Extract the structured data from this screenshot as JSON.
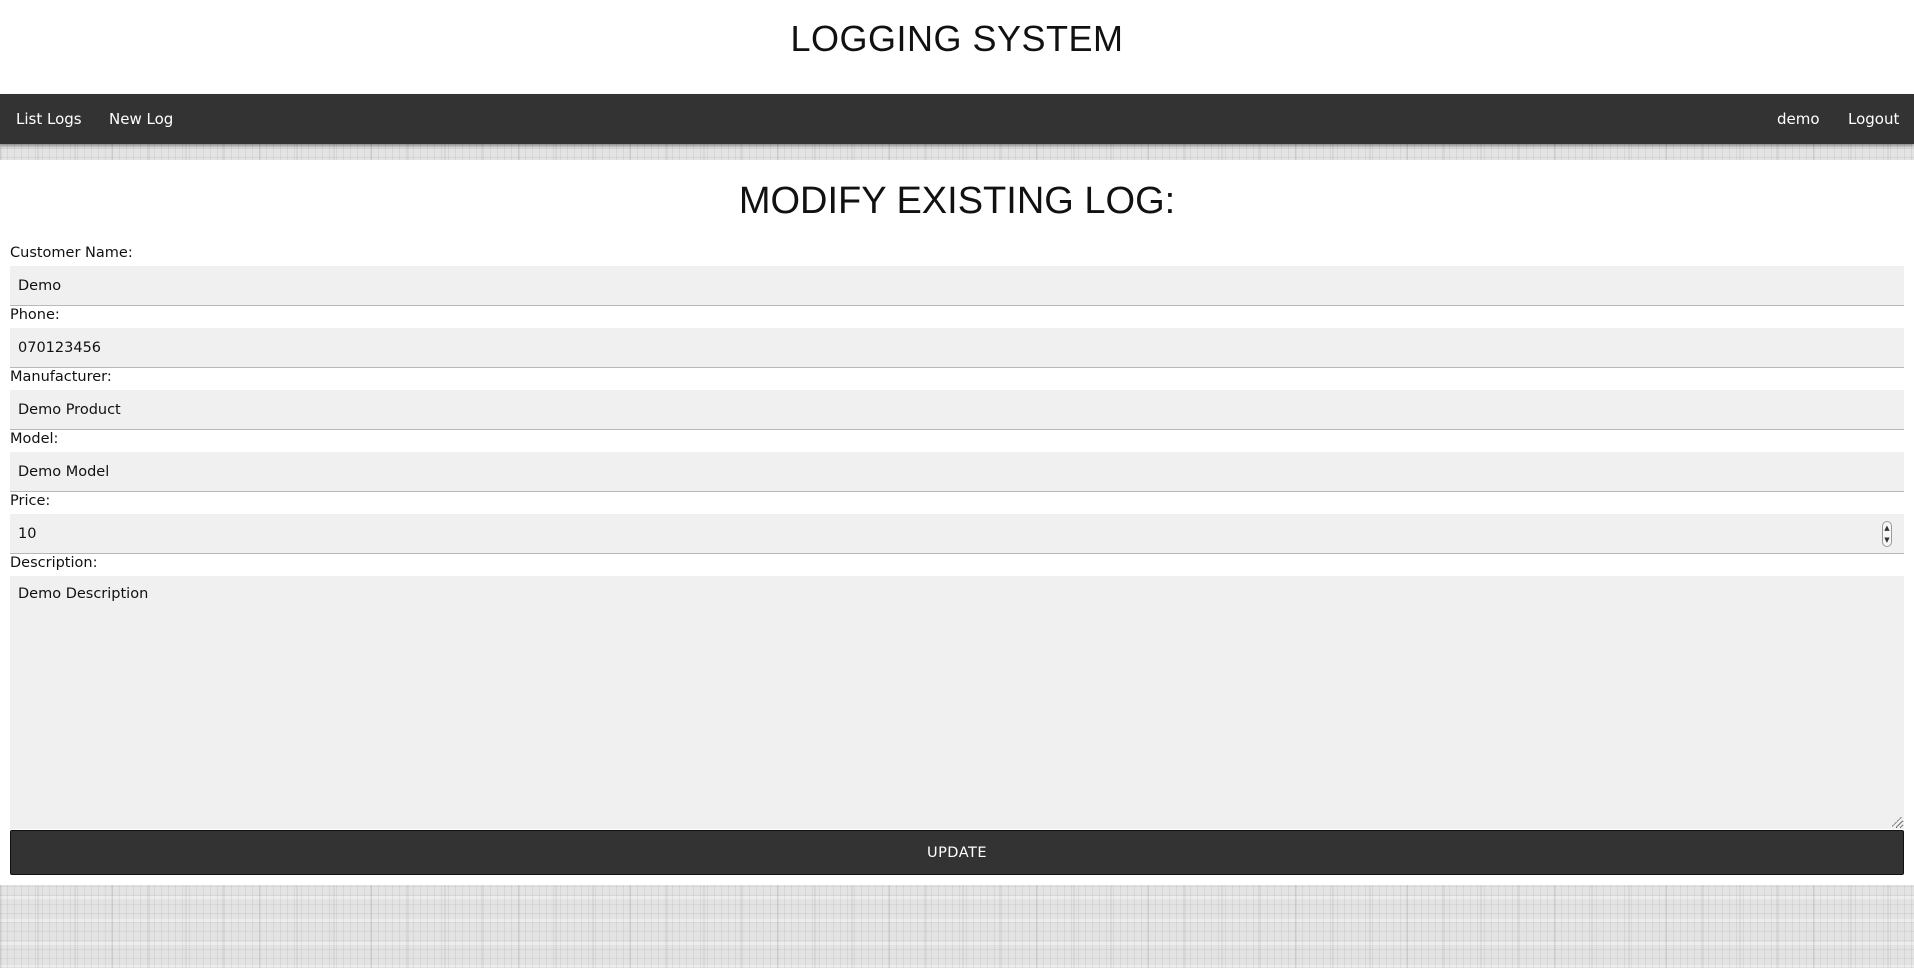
{
  "header": {
    "title": "LOGGING SYSTEM"
  },
  "nav": {
    "left": [
      {
        "label": "List Logs"
      },
      {
        "label": "New Log"
      }
    ],
    "user": "demo",
    "logout": "Logout"
  },
  "main": {
    "heading": "MODIFY EXISTING LOG:",
    "fields": {
      "customer_name": {
        "label": "Customer Name:",
        "value": "Demo"
      },
      "phone": {
        "label": "Phone:",
        "value": "070123456"
      },
      "manufacturer": {
        "label": "Manufacturer:",
        "value": "Demo Product"
      },
      "model": {
        "label": "Model:",
        "value": "Demo Model"
      },
      "price": {
        "label": "Price:",
        "value": "10"
      },
      "description": {
        "label": "Description:",
        "value": "Demo Description"
      }
    },
    "submit_label": "UPDATE"
  },
  "colors": {
    "navbar": "#333333",
    "input_background": "#f0f0f0",
    "button": "#333333"
  }
}
